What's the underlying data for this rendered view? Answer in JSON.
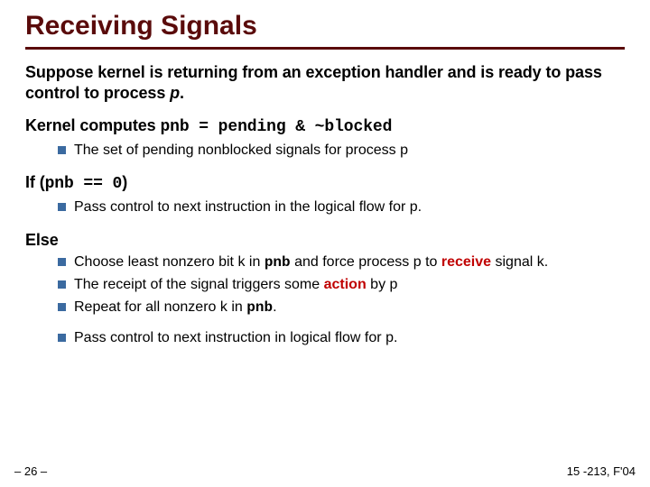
{
  "title": "Receiving Signals",
  "p1": {
    "a": "Suppose  kernel is returning from an exception handler and is ready to pass control to process",
    "p": "p",
    "dot": "."
  },
  "p2": {
    "a": "Kernel computes",
    "code": "pnb = pending & ~blocked",
    "b1": {
      "a": "The set of pending nonblocked signals for process",
      "p": "p"
    }
  },
  "p3": {
    "a": "If (",
    "code": "pnb == 0",
    "b": ")",
    "b1": {
      "a": "Pass control to next instruction in the logical flow for",
      "p": "p",
      "dot": "."
    }
  },
  "p4": {
    "a": "Else",
    "b1": {
      "a": "Choose least nonzero bit",
      "k": "k",
      "b": "in",
      "code": "pnb",
      "c": "and force process",
      "p": "p",
      "d": "to",
      "recv": "receive",
      "e": "signal",
      "k2": "k",
      "dot": "."
    },
    "b2": {
      "a": "The receipt of the signal triggers some",
      "action": "action",
      "b": "by",
      "p": "p"
    },
    "b3": {
      "a": "Repeat for all nonzero",
      "k": "k",
      "b": "in",
      "code": "pnb",
      "dot": "."
    },
    "b4": {
      "a": "Pass control to next instruction in logical flow for",
      "p": "p",
      "dot": "."
    }
  },
  "footer": {
    "left": "– 26 –",
    "right": "15 -213, F'04"
  }
}
